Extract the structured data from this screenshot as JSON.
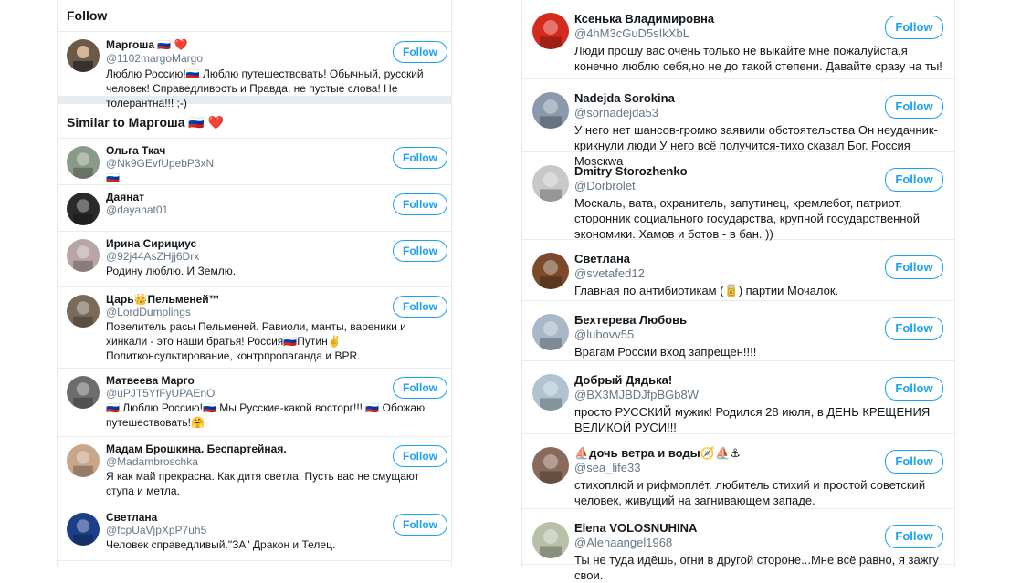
{
  "left": {
    "follow_heading": "Follow",
    "similar_heading": "Similar to Маргоша 🇷🇺 ❤️",
    "featured": {
      "name": "Маргоша 🇷🇺 ❤️",
      "handle": "@1102margoMargo",
      "bio": "Люблю Россию!🇷🇺 Люблю путешествовать! Обычный, русский человек! Справедливость и Правда, не пустые слова! Не толерантна!!! ;-)",
      "avatar_color": "#6b5a4a"
    },
    "users": [
      {
        "name": "Ольга Ткач",
        "handle": "@Nk9GEvfUpebP3xN",
        "bio": "🇷🇺",
        "avatar_color": "#8a9a88"
      },
      {
        "name": "Даянат",
        "handle": "@dayanat01",
        "bio": "",
        "avatar_color": "#2a2a2a"
      },
      {
        "name": "Ирина Сирициус",
        "handle": "@92j44AsZHjj6Drx",
        "bio": "Родину люблю. И Землю.",
        "avatar_color": "#b8a6a6"
      },
      {
        "name": "Царь👑Пельменей™",
        "handle": "@LordDumplings",
        "bio": "Повелитель расы Пельменей. Равиоли, манты, вареники и хинкали - это наши братья! Россия🇷🇺Путин✌️ Политконсультирование, контрпропаганда и BPR.",
        "avatar_color": "#7a6a5a"
      },
      {
        "name": "Матвеева Марго",
        "handle": "@uPJT5YfFyUPAEnO",
        "bio": "🇷🇺 Люблю Россию!🇷🇺 Мы Русские-какой восторг!!! 🇷🇺 Обожаю путешествовать!🤗",
        "avatar_color": "#6d6d6d"
      },
      {
        "name": "Мадам Брошкина. Беспартейная.",
        "handle": "@Madambroschka",
        "bio": "Я как май прекрасна. Как дитя светла. Пусть вас не смущают ступа и метла.",
        "avatar_color": "#c9a58a"
      },
      {
        "name": "Светлана",
        "handle": "@fcpUaVjpXpP7uh5",
        "bio": "Человек справедливый.\"ЗА\" Дракон и Телец.",
        "avatar_color": "#1d3f8a"
      }
    ]
  },
  "right": {
    "users": [
      {
        "name": "Ксенька Владимировна",
        "handle": "@4hM3cGuD5sIkXbL",
        "bio": "Люди прошу вас очень только не выкайте мне пожалуйста,я конечно люблю себя,но не до такой степени. Давайте сразу на ты!",
        "avatar_color": "#d52b1e"
      },
      {
        "name": "Nadejda Sorokina",
        "handle": "@sornadejda53",
        "bio": "У него нет шансов-громко заявили обстоятельства Он неудачник-крикнули люди У него всё получится-тихо сказал Бог. Россия Moscкwa",
        "avatar_color": "#8a9aaa"
      },
      {
        "name": "Dmitry Storozhenko",
        "handle": "@Dorbrolet",
        "bio": "Москаль, вата, охранитель, запутинец, кремлебот, патриот, сторонник социального государства, крупной государственной экономики. Хамов и ботов - в бан. ))",
        "avatar_color": "#c8c8c8"
      },
      {
        "name": "Светлана",
        "handle": "@svetafed12",
        "bio": "Главная по антибиотикам (🥫) партии Мочалок.",
        "avatar_color": "#7a4a2a"
      },
      {
        "name": "Бехтерева Любовь",
        "handle": "@lubovv55",
        "bio": "Врагам России вход запрещен!!!!",
        "avatar_color": "#a9b8c8"
      },
      {
        "name": "Добрый Дядька!",
        "handle": "@BX3MJBDJfpBGb8W",
        "bio": "просто РУССКИЙ мужик! Родился 28 июля, в ДЕНЬ КРЕЩЕНИЯ ВЕЛИКОЙ РУСИ!!!",
        "avatar_color": "#b0c4d0"
      },
      {
        "name": "⛵дочь ветра и воды🧭⛵⚓",
        "handle": "@sea_life33",
        "bio": "стихоплюй и рифмоплёт. любитель стихий и простой советский человек, живущий на загнивающем западе.",
        "avatar_color": "#8a6a5a"
      },
      {
        "name": "Elena VOLOSNUHINA",
        "handle": "@Alenaangel1968",
        "bio": "Ты не туда идёшь, огни в другой стороне...Мне всё равно, я зажгу свои.",
        "avatar_color": "#b8c0a8"
      }
    ]
  },
  "follow_label": "Follow"
}
